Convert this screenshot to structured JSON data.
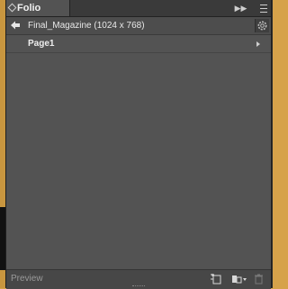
{
  "panel": {
    "tab_label": "Folio Builder"
  },
  "folio": {
    "title": "Final_Magazine (1024 x 768)"
  },
  "pages": [
    {
      "label": "Page1"
    }
  ],
  "footer": {
    "preview_label": "Preview"
  },
  "icons": {
    "collapse": "double-chevron-right-icon",
    "panel_menu": "panel-menu-icon",
    "back": "back-arrow-icon",
    "settings": "gear-icon",
    "expand": "triangle-right-icon",
    "new_article": "new-article-icon",
    "import": "import-icon",
    "delete": "trash-icon"
  }
}
